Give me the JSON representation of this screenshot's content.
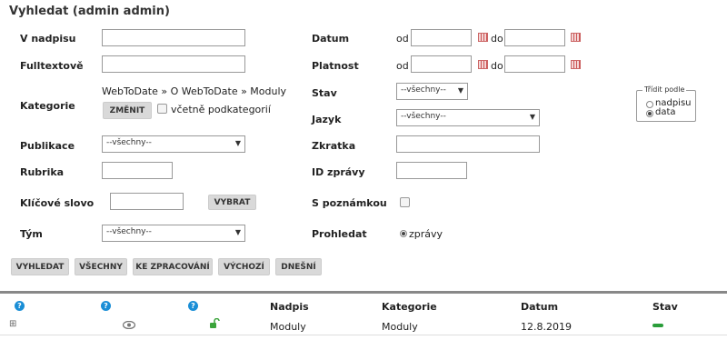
{
  "title": "Vyhledat (admin admin)",
  "form": {
    "heading_label": "V nadpisu",
    "fulltext_label": "Fulltextově",
    "category_label": "Kategorie",
    "category_path": "WebToDate » O WebToDate » Moduly",
    "change_button": "ZMĚNIT",
    "include_subcats_label": "včetně podkategorií",
    "publication_label": "Publikace",
    "publication_value": "--všechny--",
    "section_label": "Rubrika",
    "keyword_label": "Klíčové slovo",
    "choose_button": "VYBRAT",
    "team_label": "Tým",
    "team_value": "--všechny--",
    "date_label": "Datum",
    "validity_label": "Platnost",
    "from": "od",
    "to": "do",
    "state_label": "Stav",
    "state_value": "--všechny--",
    "language_label": "Jazyk",
    "language_value": "--všechny--",
    "shortcut_label": "Zkratka",
    "news_id_label": "ID zprávy",
    "with_note_label": "S poznámkou",
    "search_in_label": "Prohledat",
    "search_in_value": "zprávy",
    "sort_title": "Třídit podle",
    "sort_options": [
      "nadpisu",
      "data"
    ],
    "sort_selected": "data"
  },
  "buttons": {
    "search": "VYHLEDAT",
    "all": "VŠECHNY",
    "to_process": "KE ZPRACOVÁNÍ",
    "default": "VÝCHOZÍ",
    "today": "DNEŠNÍ"
  },
  "table": {
    "help_glyph": "?",
    "columns": [
      "Nadpis",
      "Kategorie",
      "Datum",
      "Stav"
    ],
    "rows": [
      {
        "expand": "⊞",
        "title": "Moduly",
        "category": "Moduly",
        "date": "12.8.2019",
        "status_color": "#2a9d3a"
      }
    ]
  }
}
